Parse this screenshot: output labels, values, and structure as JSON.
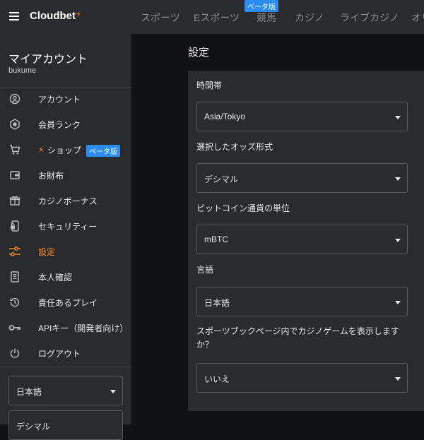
{
  "header": {
    "brand": "Cloudbet",
    "beta_badge": "ベータ版",
    "nav": [
      "スポーツ",
      "Eスポーツ",
      "競馬",
      "カジノ",
      "ライブカジノ",
      "オリ"
    ]
  },
  "sidebar": {
    "title": "マイアカウント",
    "username": "bukume",
    "items": [
      {
        "label": "アカウント",
        "icon": "user-circle-icon"
      },
      {
        "label": "会員ランク",
        "icon": "rank-badge-icon"
      },
      {
        "label": "ショップ",
        "icon": "cart-icon",
        "badge": "ベータ版"
      },
      {
        "label": "お財布",
        "icon": "wallet-icon"
      },
      {
        "label": "カジノボーナス",
        "icon": "gift-icon"
      },
      {
        "label": "セキュリティー",
        "icon": "phone-lock-icon"
      },
      {
        "label": "設定",
        "icon": "sliders-icon",
        "active": true
      },
      {
        "label": "本人確認",
        "icon": "id-document-icon"
      },
      {
        "label": "責任あるプレイ",
        "icon": "history-icon"
      },
      {
        "label": "APIキー（開発者向け）",
        "icon": "key-icon"
      },
      {
        "label": "ログアウト",
        "icon": "power-icon"
      }
    ],
    "language_value": "日本語",
    "odds_value": "デシマル"
  },
  "main": {
    "title": "設定",
    "fields": [
      {
        "label": "時間帯",
        "value": "Asia/Tokyo"
      },
      {
        "label": "選択したオッズ形式",
        "value": "デシマル"
      },
      {
        "label": "ビットコイン通貨の単位",
        "value": "mBTC"
      },
      {
        "label": "言語",
        "value": "日本語"
      },
      {
        "label": "スポーツブックページ内でカジノゲームを表示しますか？",
        "value": "いいえ"
      }
    ]
  },
  "colors": {
    "accent": "#ff8a1f",
    "beta": "#2d8cf0",
    "panel": "#2a2b2e",
    "background": "#111214"
  }
}
